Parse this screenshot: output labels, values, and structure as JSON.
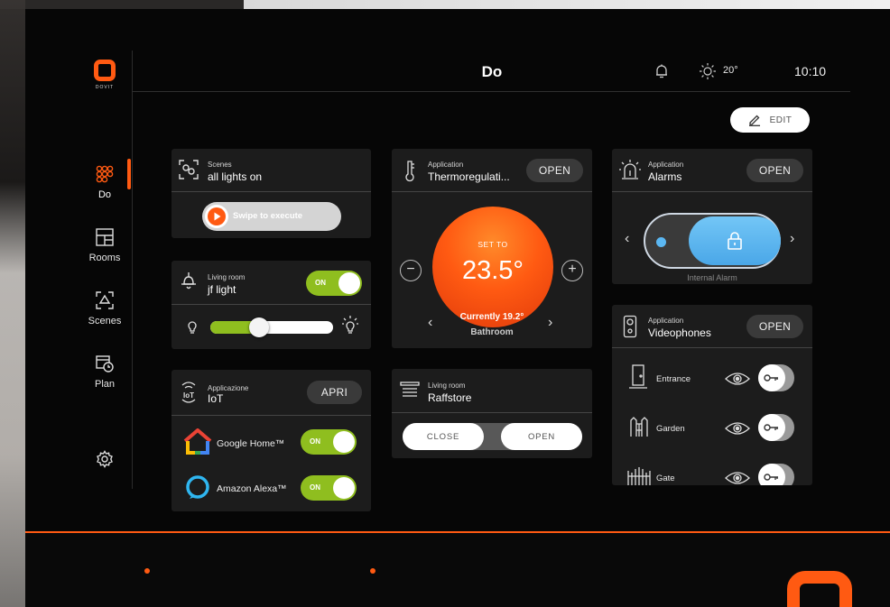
{
  "brand": {
    "name": "DOVIT"
  },
  "colors": {
    "accent": "#ff5a12",
    "toggle_on": "#8fbe1f",
    "alarm_blue": "#5bb7f2",
    "card_bg": "#1c1c1c"
  },
  "header": {
    "title": "Do",
    "weather_icon": "sun-icon",
    "temperature": "20°",
    "time": "10:10",
    "edit_label": "EDIT"
  },
  "sidebar": {
    "items": [
      {
        "label": "Do",
        "icon": "grid-icon",
        "active": true
      },
      {
        "label": "Rooms",
        "icon": "floorplan-icon",
        "active": false
      },
      {
        "label": "Scenes",
        "icon": "scenes-icon",
        "active": false
      },
      {
        "label": "Plan",
        "icon": "calendar-clock-icon",
        "active": false
      }
    ],
    "settings_icon": "gear-icon"
  },
  "cards": {
    "scenes": {
      "category": "Scenes",
      "title": "all lights on",
      "swipe_label": "Swipe to execute"
    },
    "light": {
      "room": "Living room",
      "title": "jf light",
      "toggle": "ON",
      "level": 0.4
    },
    "iot": {
      "category": "Applicazione",
      "title": "IoT",
      "open_label": "APRI",
      "services": [
        {
          "name": "Google Home™",
          "toggle": "ON"
        },
        {
          "name": "Amazon Alexa™",
          "toggle": "ON"
        }
      ]
    },
    "thermo": {
      "category": "Application",
      "title": "Thermoregulati...",
      "open_label": "OPEN",
      "set_label": "SET TO",
      "setpoint": "23.5°",
      "current": "Currently 19.2°",
      "room": "Bathroom"
    },
    "raffstore": {
      "room": "Living room",
      "title": "Raffstore",
      "close_label": "CLOSE",
      "open_label": "OPEN"
    },
    "alarms": {
      "category": "Application",
      "title": "Alarms",
      "open_label": "OPEN",
      "label": "Internal Alarm"
    },
    "videophones": {
      "category": "Application",
      "title": "Videophones",
      "open_label": "OPEN",
      "entries": [
        {
          "name": "Entrance",
          "icon": "door-icon"
        },
        {
          "name": "Garden",
          "icon": "garden-gate-icon"
        },
        {
          "name": "Gate",
          "icon": "gate-icon"
        }
      ]
    }
  }
}
